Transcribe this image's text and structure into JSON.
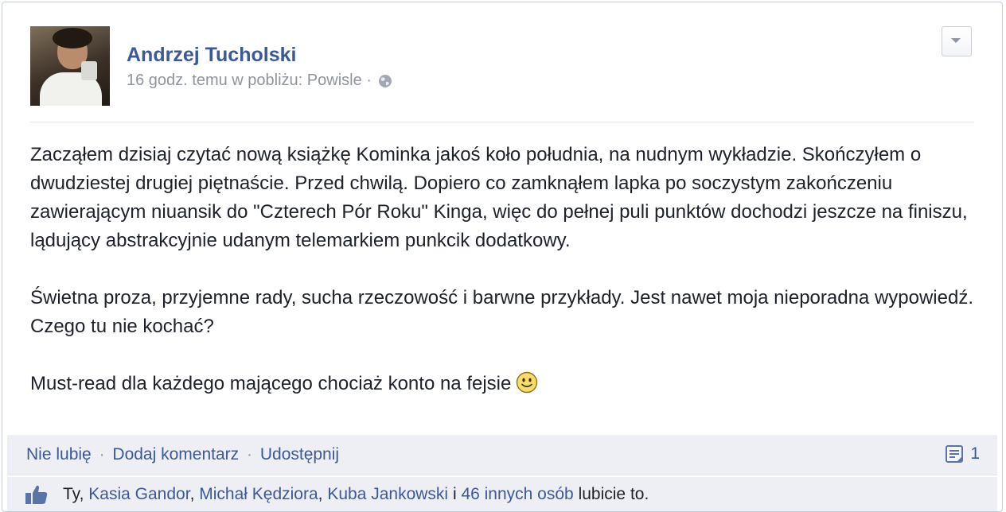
{
  "post": {
    "author": "Andrzej Tucholski",
    "meta_text": "16 godz. temu w pobliżu: Powisle ·",
    "paragraphs": [
      "Zacząłem dzisiaj czytać nową książkę Kominka jakoś koło południa, na nudnym wykładzie. Skończyłem o dwudziestej drugiej piętnaście. Przed chwilą. Dopiero co zamknąłem lapka po soczystym zakończeniu zawierającym niuansik do \"Czterech Pór Roku\" Kinga, więc do pełnej puli punktów dochodzi jeszcze na finiszu, lądujący abstrakcyjnie udanym telemarkiem punkcik dodatkowy.",
      "Świetna proza, przyjemne rady, sucha rzeczowość i barwne przykłady. Jest nawet moja nieporadna wypowiedź. Czego tu nie kochać?",
      "Must-read dla każdego mającego chociaż konto na fejsie"
    ]
  },
  "actions": {
    "unlike": "Nie lubię",
    "comment": "Dodaj komentarz",
    "share": "Udostępnij",
    "separator": "·",
    "comment_count": "1"
  },
  "likes": {
    "you": "Ty,",
    "person1": "Kasia Gandor",
    "person2": "Michał Kędziora",
    "person3": "Kuba Jankowski",
    "conjunction": "i",
    "others": "46 innych osób",
    "suffix": "lubicie to.",
    "comma": ","
  },
  "icons": {
    "privacy": "globe-icon",
    "menu": "chevron-down-icon",
    "comments": "comment-icon",
    "like": "thumbs-up-icon",
    "emoji": "smiley-icon"
  },
  "colors": {
    "link": "#3b5998",
    "meta": "#90949c",
    "footer_bg": "#edeff4"
  }
}
